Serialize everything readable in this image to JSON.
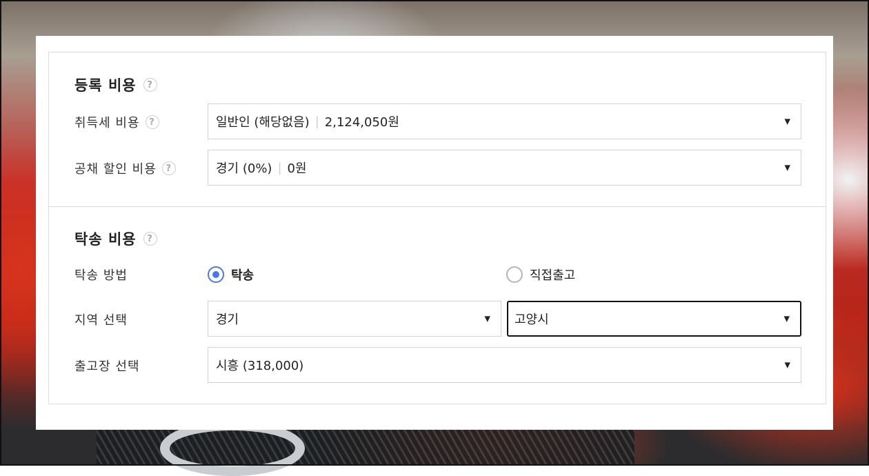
{
  "registration": {
    "title": "등록 비용",
    "acquisition_tax": {
      "label": "취득세 비용",
      "value": "일반인 (해당없음)",
      "amount": "2,124,050원"
    },
    "bond_discount": {
      "label": "공채 할인 비용",
      "value": "경기 (0%)",
      "amount": "0원"
    }
  },
  "delivery": {
    "title": "탁송 비용",
    "method": {
      "label": "탁송 방법",
      "options": [
        {
          "label": "탁송",
          "selected": true
        },
        {
          "label": "직접출고",
          "selected": false
        }
      ]
    },
    "region": {
      "label": "지역 선택",
      "province": "경기",
      "city": "고양시"
    },
    "release": {
      "label": "출고장 선택",
      "value": "시흥 (318,000)"
    }
  },
  "icons": {
    "help": "?",
    "caret": "▼"
  },
  "colors": {
    "accent": "#4a78e8"
  }
}
